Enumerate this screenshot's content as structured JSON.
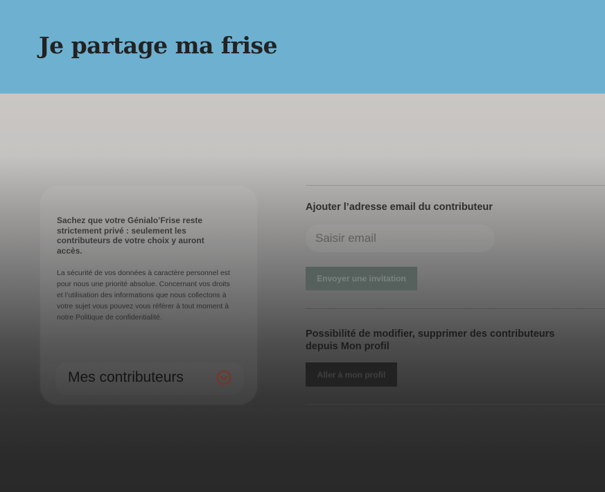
{
  "header": {
    "title": "Je partage ma frise"
  },
  "info": {
    "intro": "Sachez que votre Génialo’Frise reste strictement privé : seulement les contributeurs de votre choix y auront accès.",
    "body": "La sécurité de vos données à caractère personnel est pour nous une priorité absolue. Concernant vos droits et l’utilisation des informations que nous collectons à votre sujet vous pouvez vous référer à tout moment à notre Politique de confidentialité.",
    "contributors_toggle": {
      "label": "Mes contributeurs",
      "icon": "chevron-down-icon",
      "accent_color": "#8a2b1c"
    }
  },
  "invite": {
    "title": "Ajouter l’adresse email du contributeur",
    "email_placeholder": "Saisir email",
    "email_value": "",
    "button_label": "Envoyer une invitation"
  },
  "manage": {
    "title": "Possibilité de modifier, supprimer des contributeurs depuis Mon profil",
    "button_label": "Aller à mon profil"
  },
  "colors": {
    "header_bg": "#6eb0cf",
    "invite_button_bg": "#56605d",
    "profile_button_bg": "#222222"
  }
}
